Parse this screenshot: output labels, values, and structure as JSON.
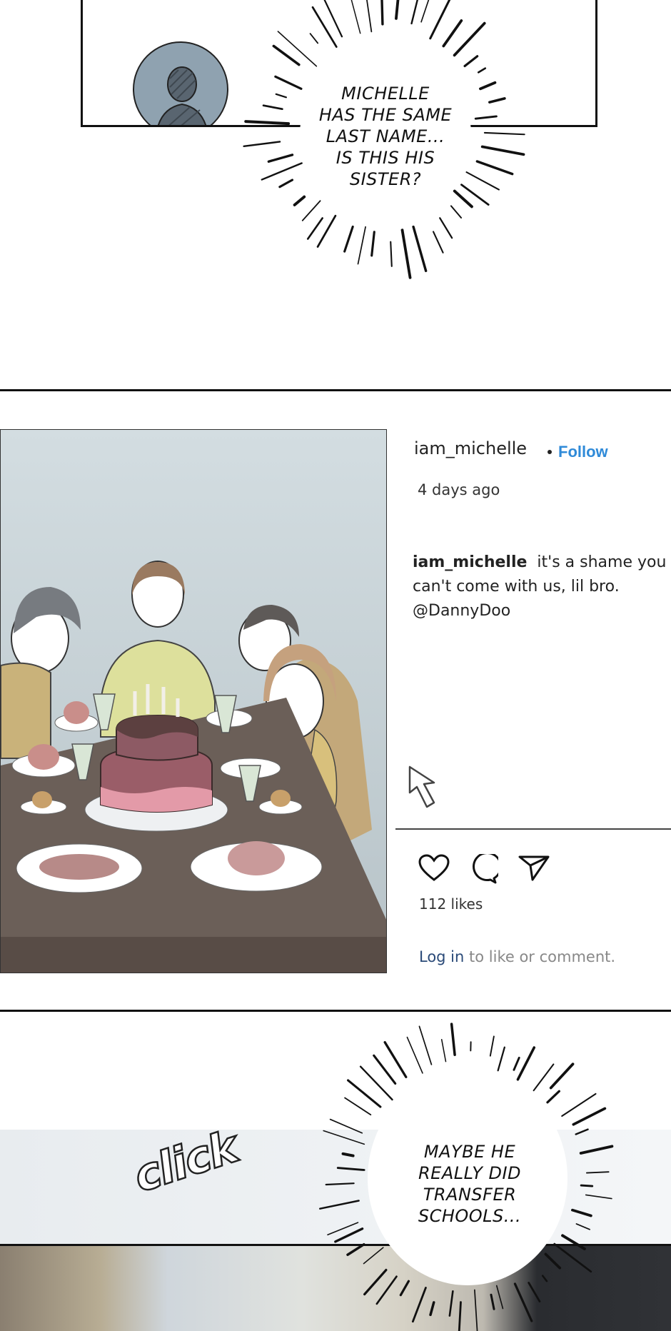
{
  "top_panel": {
    "bubble_text": "MICHELLE\nHAS THE SAME\nLAST NAME...\nIS THIS HIS\nSISTER?"
  },
  "post": {
    "username": "iam_michelle",
    "follow_label": "Follow",
    "time_ago": "4 days ago",
    "caption_user": "iam_michelle",
    "caption_text": "it's a shame you can't come with us, lil bro. @DannyDoo",
    "likes": "112 likes",
    "login_link": "Log in",
    "login_rest": "to like or comment."
  },
  "bottom_panel": {
    "sfx": "click",
    "bubble_text": "MAYBE HE\nREALLY DID\nTRANSFER\nSCHOOLS..."
  },
  "colors": {
    "follow_blue": "#2f8ad8",
    "login_blue": "#2a4a78"
  }
}
